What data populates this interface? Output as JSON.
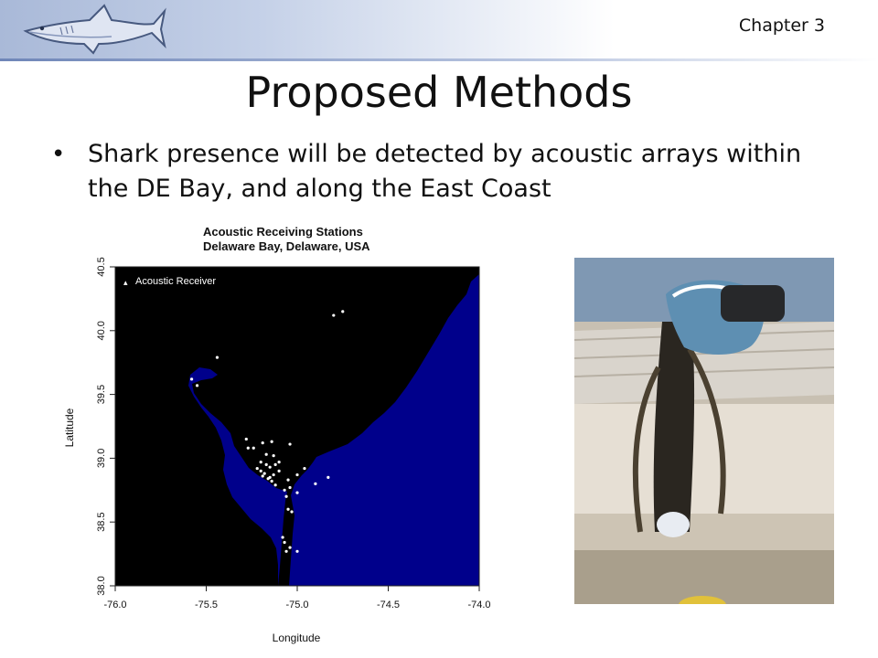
{
  "header": {
    "chapter": "Chapter 3",
    "logo_icon": "shark-icon"
  },
  "slide": {
    "title": "Proposed Methods",
    "bullet": "Shark presence will be detected by acoustic arrays within the DE Bay, and along the East Coast"
  },
  "chart_data": {
    "type": "scatter",
    "title": "Acoustic Receiving Stations",
    "subtitle": "Delaware Bay, Delaware, USA",
    "xlabel": "Longitude",
    "ylabel": "Latitude",
    "xlim": [
      -76.0,
      -74.0
    ],
    "ylim": [
      38.0,
      40.5
    ],
    "xticks": [
      "-76.0",
      "-75.5",
      "-75.0",
      "-74.5",
      "-74.0"
    ],
    "yticks": [
      "38.0",
      "38.5",
      "39.0",
      "39.5",
      "40.0",
      "40.5"
    ],
    "legend": "Acoustic Receiver",
    "legend_position": "top-left",
    "colors": {
      "land": "#000000",
      "water": "#00008b",
      "points": "#ffffff"
    },
    "series": [
      {
        "name": "Acoustic Receiver",
        "x": [
          -74.8,
          -74.75,
          -75.44,
          -75.58,
          -75.55,
          -75.28,
          -75.24,
          -75.19,
          -75.14,
          -75.04,
          -75.17,
          -75.13,
          -75.2,
          -75.17,
          -75.15,
          -75.12,
          -75.1,
          -75.2,
          -75.18,
          -75.15,
          -75.13,
          -75.1,
          -75.22,
          -75.19,
          -75.16,
          -75.14,
          -75.27,
          -75.12,
          -75.05,
          -75.0,
          -74.96,
          -74.9,
          -74.83,
          -75.07,
          -75.06,
          -75.04,
          -75.0,
          -75.05,
          -75.03,
          -75.08,
          -75.07,
          -75.04,
          -75.06,
          -75.0
        ],
        "y": [
          40.12,
          40.15,
          39.79,
          39.62,
          39.57,
          39.15,
          39.08,
          39.12,
          39.13,
          39.11,
          39.03,
          39.02,
          38.97,
          38.95,
          38.93,
          38.95,
          38.97,
          38.9,
          38.88,
          38.85,
          38.87,
          38.9,
          38.92,
          38.86,
          38.84,
          38.82,
          39.08,
          38.79,
          38.83,
          38.87,
          38.92,
          38.8,
          38.85,
          38.75,
          38.7,
          38.77,
          38.73,
          38.6,
          38.58,
          38.38,
          38.34,
          38.3,
          38.27,
          38.27
        ]
      }
    ]
  }
}
